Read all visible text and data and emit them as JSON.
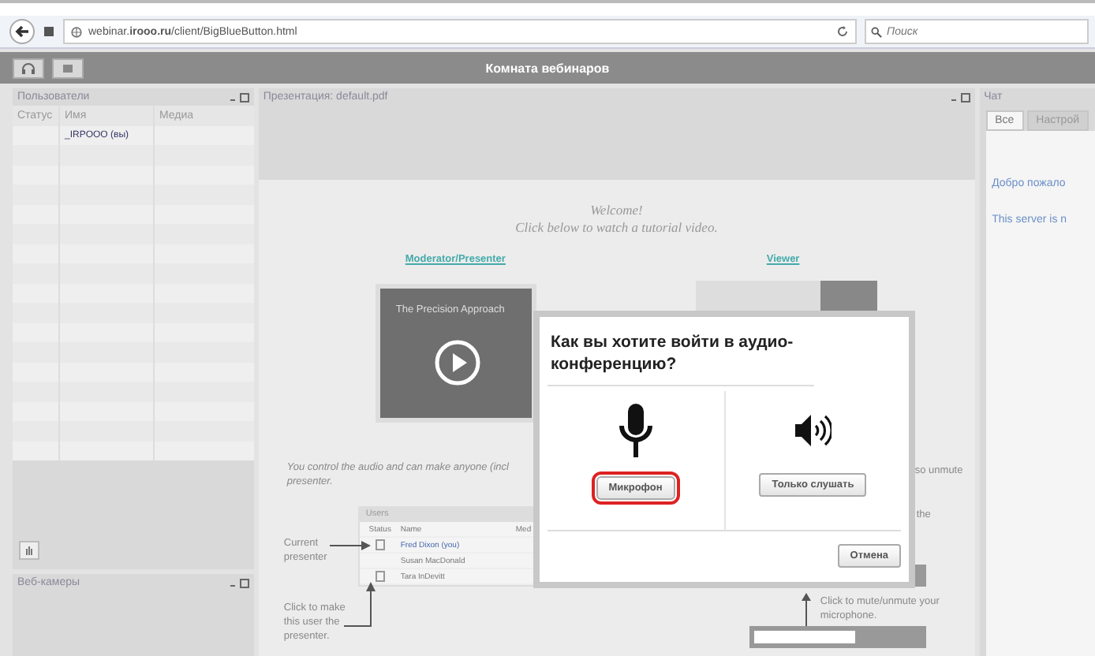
{
  "browser": {
    "url": "webinar.**irooo.ru**/client/BigBlueButton.html",
    "search": {
      "placeholder": "Поиск"
    }
  },
  "app_title": "Комната вебинаров",
  "users_panel": {
    "title": "Пользователи",
    "columns": [
      "Статус",
      "Имя",
      "Медиа"
    ],
    "rows": [
      {
        "name": "_IRPOOO (вы)"
      }
    ]
  },
  "webcams_panel": {
    "title": "Веб-камеры"
  },
  "presentation": {
    "title": "Презентация: default.pdf",
    "slide": {
      "welcome": "Welcome!",
      "subtitle": "Click below to watch a tutorial video.",
      "links": [
        "Moderator/Presenter",
        "Viewer"
      ],
      "video_title": "The Precision Approach",
      "paragraph": [
        "You control the audio and can make anyone (incl",
        "presenter."
      ],
      "users_table": {
        "title": "Users",
        "columns": [
          "Status",
          "Name",
          "Med"
        ],
        "rows": [
          "Fred Dixon (you)",
          "Susan MacDonald",
          "Tara InDevitt"
        ]
      },
      "callouts": [
        "Current presenter",
        "Click to make this user the presenter.",
        "so unmute",
        "the",
        "Click to mute/unmute your microphone."
      ]
    }
  },
  "chat": {
    "title": "Чат",
    "tabs": [
      {
        "label": "Все",
        "selected": true
      },
      {
        "label": "Настрой",
        "selected": false
      }
    ],
    "messages": [
      "Добро пожало",
      "This server is n"
    ]
  },
  "dialog": {
    "title": "Как вы хотите войти в аудио-конференцию?",
    "options": [
      {
        "kind": "microphone",
        "label": "Микрофон",
        "highlighted": true
      },
      {
        "kind": "listen",
        "label": "Только слушать",
        "highlighted": false
      }
    ],
    "cancel": "Отмена"
  }
}
